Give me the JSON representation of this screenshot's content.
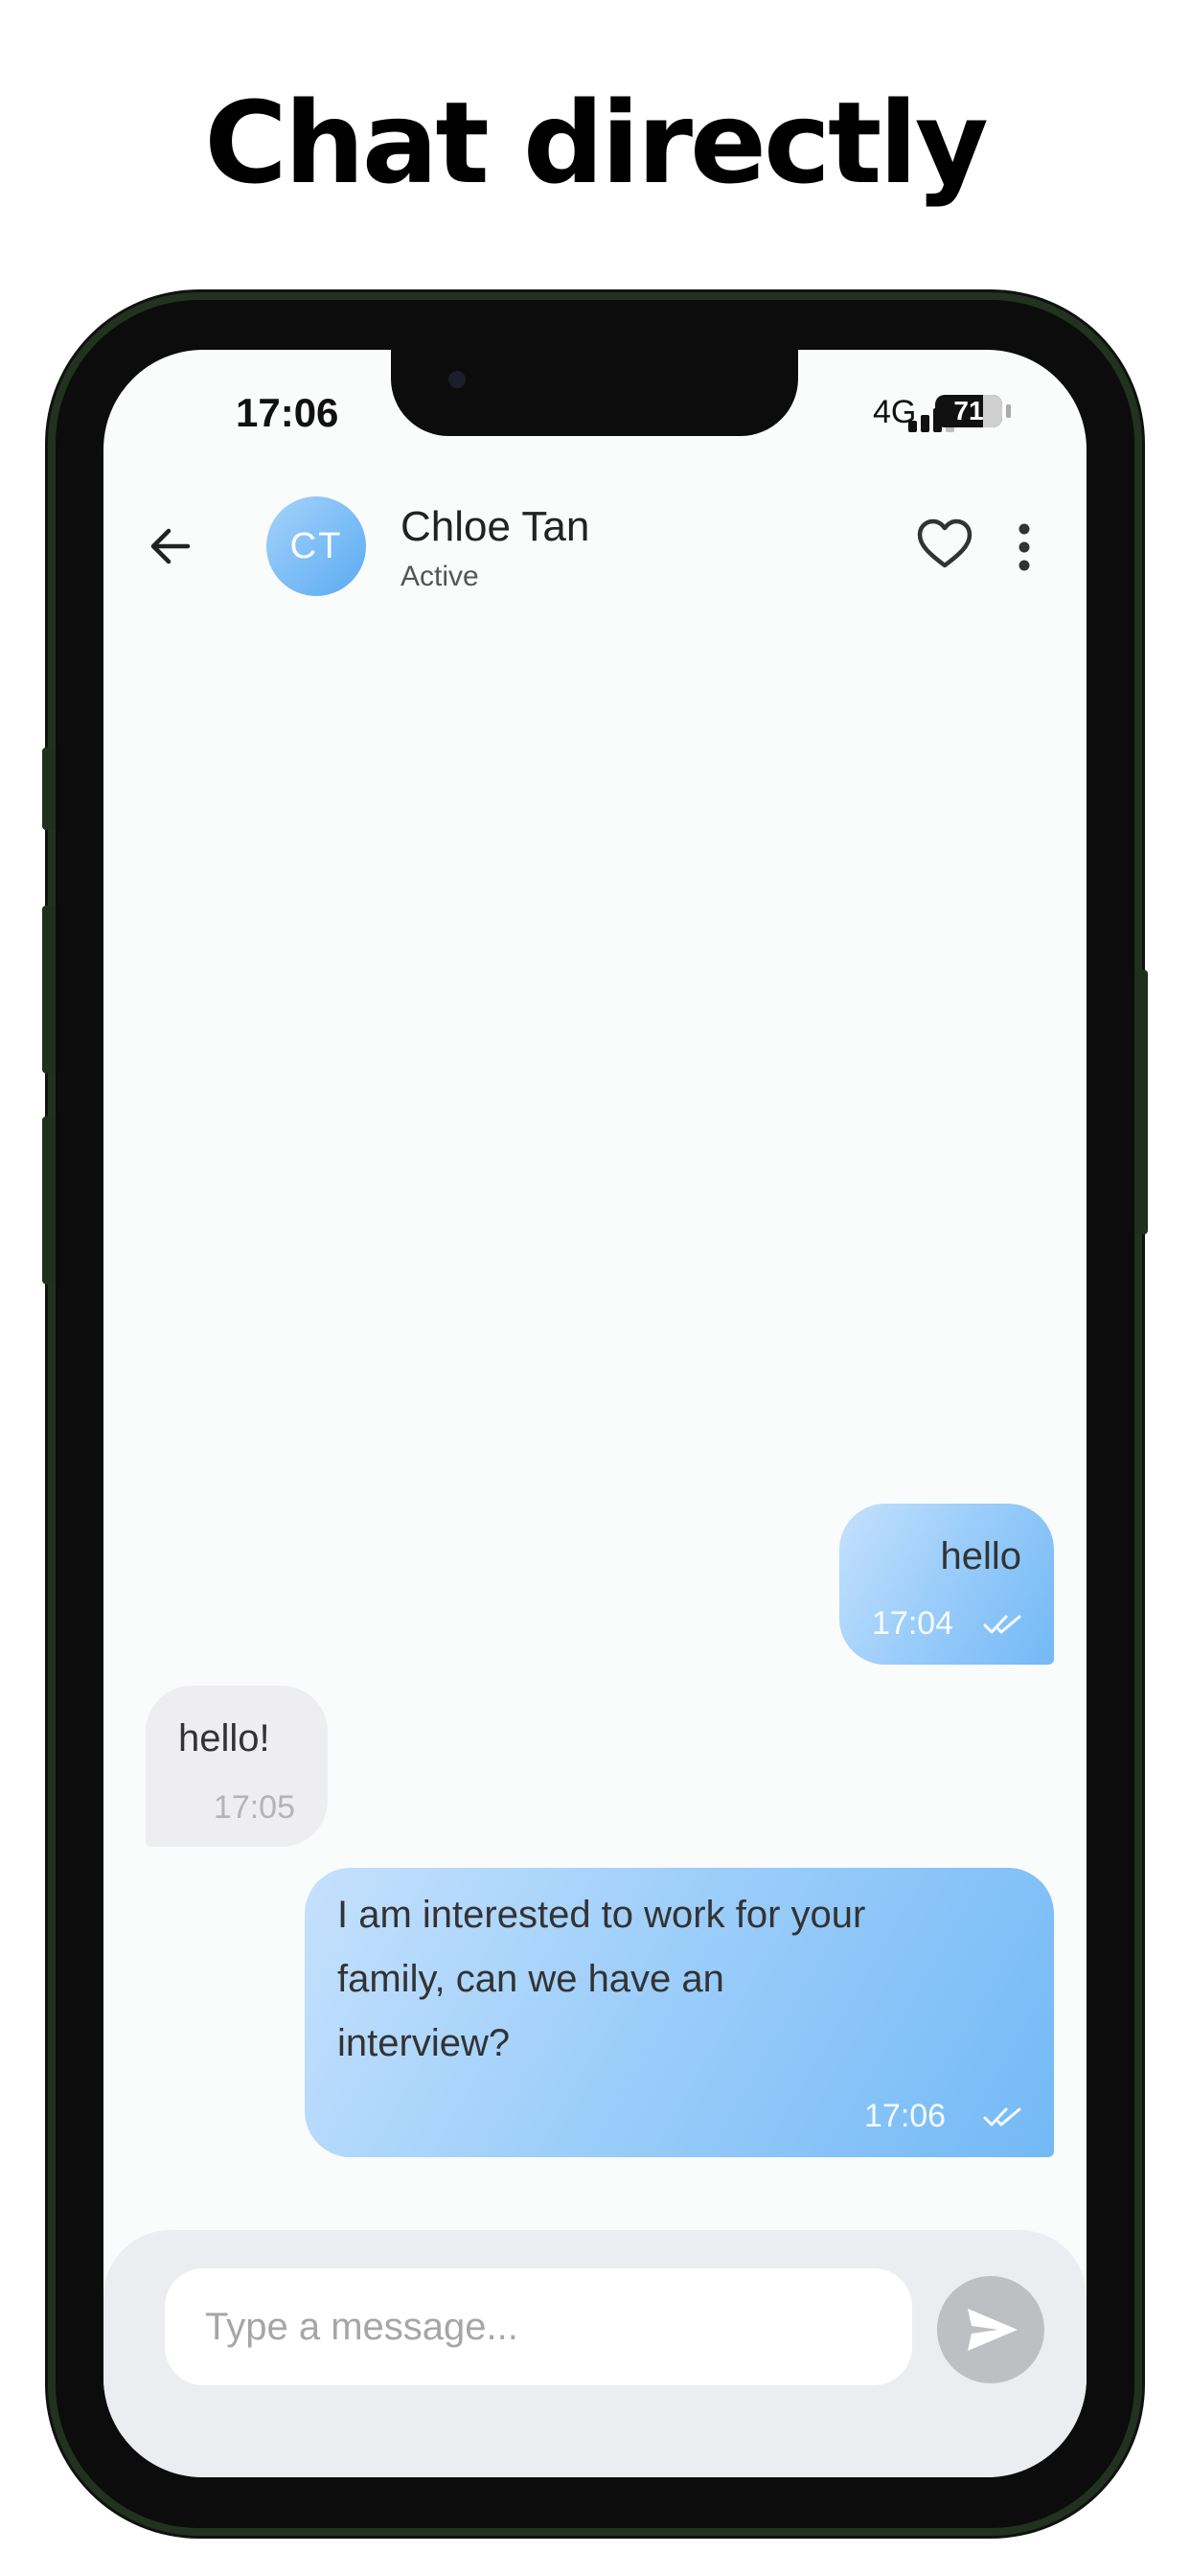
{
  "headline": "Chat directly",
  "status_bar": {
    "time": "17:06",
    "network": "4G",
    "battery_percent": "71",
    "battery_level": 0.71,
    "signal_bars_active": 3
  },
  "header": {
    "avatar_initials": "CT",
    "contact_name": "Chloe Tan",
    "presence": "Active",
    "back_icon": "arrow-left-icon",
    "favorite_icon": "heart-outline-icon",
    "menu_icon": "more-vertical-icon"
  },
  "messages": [
    {
      "direction": "outgoing",
      "text": "hello",
      "time": "17:04",
      "status_icon": "double-check-icon"
    },
    {
      "direction": "incoming",
      "text": "hello!",
      "time": "17:05"
    },
    {
      "direction": "outgoing",
      "lines": [
        "I am interested to work for your",
        "family, can we have an",
        "interview?"
      ],
      "time": "17:06",
      "status_icon": "double-check-icon"
    }
  ],
  "composer": {
    "placeholder": "Type a message...",
    "value": "",
    "send_icon": "send-icon"
  },
  "colors": {
    "outgoing_bubble_start": "#c5e1fd",
    "outgoing_bubble_end": "#73b9f6",
    "incoming_bubble": "#eeeef1",
    "avatar": "#5aabf2",
    "send_button": "#bebfc3",
    "phone_frame": "#21321f"
  }
}
